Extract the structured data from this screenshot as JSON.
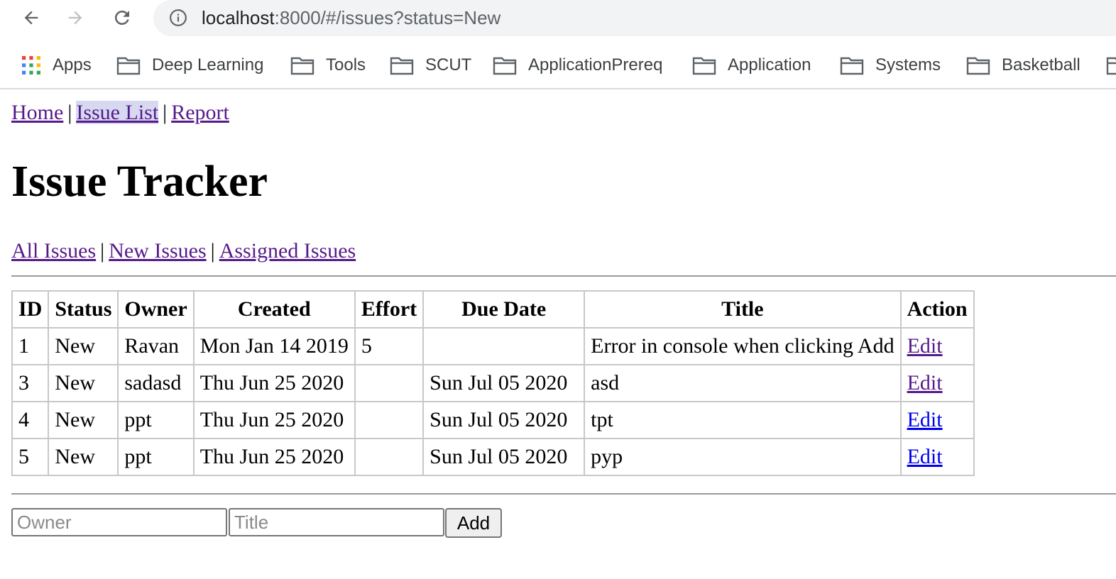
{
  "browser": {
    "url_host": "localhost",
    "url_rest": ":8000/#/issues?status=New",
    "bookmarks": [
      {
        "label": "Apps",
        "icon": "apps-grid-icon"
      },
      {
        "label": "Deep Learning",
        "icon": "folder-icon"
      },
      {
        "label": "Tools",
        "icon": "folder-icon"
      },
      {
        "label": "SCUT",
        "icon": "folder-icon"
      },
      {
        "label": "ApplicationPrereq",
        "icon": "folder-icon"
      },
      {
        "label": "Application",
        "icon": "folder-icon"
      },
      {
        "label": "Systems",
        "icon": "folder-icon"
      },
      {
        "label": "Basketball",
        "icon": "folder-icon"
      }
    ]
  },
  "nav": {
    "home": "Home",
    "issue_list": "Issue List",
    "report": "Report",
    "separator": "|"
  },
  "page": {
    "title": "Issue Tracker"
  },
  "filter": {
    "all": "All Issues",
    "new": "New Issues",
    "assigned": "Assigned Issues",
    "separator": "|"
  },
  "table": {
    "headers": [
      "ID",
      "Status",
      "Owner",
      "Created",
      "Effort",
      "Due Date",
      "Title",
      "Action"
    ],
    "rows": [
      {
        "id": "1",
        "status": "New",
        "owner": "Ravan",
        "created": "Mon Jan 14 2019",
        "effort": "5",
        "due": "",
        "title": "Error in console when clicking Add",
        "action": "Edit"
      },
      {
        "id": "3",
        "status": "New",
        "owner": "sadasd",
        "created": "Thu Jun 25 2020",
        "effort": "",
        "due": "Sun Jul 05 2020",
        "title": "asd",
        "action": "Edit"
      },
      {
        "id": "4",
        "status": "New",
        "owner": "ppt",
        "created": "Thu Jun 25 2020",
        "effort": "",
        "due": "Sun Jul 05 2020",
        "title": "tpt",
        "action": "Edit"
      },
      {
        "id": "5",
        "status": "New",
        "owner": "ppt",
        "created": "Thu Jun 25 2020",
        "effort": "",
        "due": "Sun Jul 05 2020",
        "title": "pyp",
        "action": "Edit"
      }
    ]
  },
  "add_form": {
    "owner_placeholder": "Owner",
    "title_placeholder": "Title",
    "add_label": "Add"
  }
}
